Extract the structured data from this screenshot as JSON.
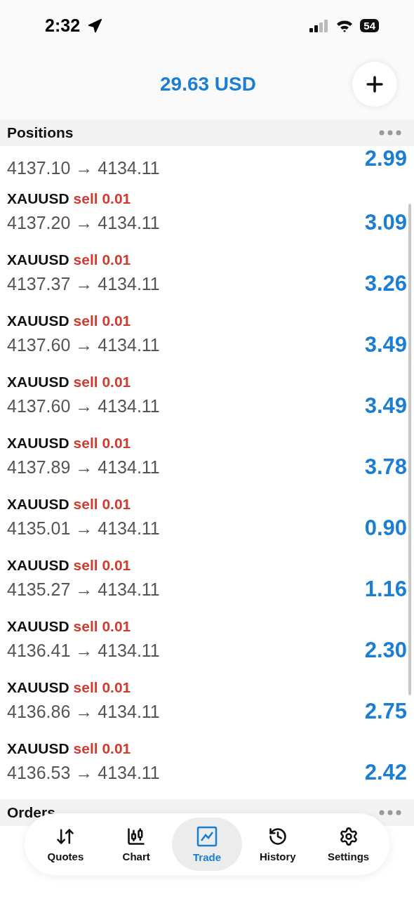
{
  "status_bar": {
    "time": "2:32",
    "battery": "54"
  },
  "account": {
    "balance": "29.63 USD"
  },
  "positions": {
    "title": "Positions",
    "rows": [
      {
        "symbol": "",
        "side": "",
        "prices": "4137.10 → 4134.11",
        "profit": "2.99"
      },
      {
        "symbol": "XAUUSD",
        "side": "sell 0.01",
        "prices": "4137.20 → 4134.11",
        "profit": "3.09"
      },
      {
        "symbol": "XAUUSD",
        "side": "sell 0.01",
        "prices": "4137.37 → 4134.11",
        "profit": "3.26"
      },
      {
        "symbol": "XAUUSD",
        "side": "sell 0.01",
        "prices": "4137.60 → 4134.11",
        "profit": "3.49"
      },
      {
        "symbol": "XAUUSD",
        "side": "sell 0.01",
        "prices": "4137.60 → 4134.11",
        "profit": "3.49"
      },
      {
        "symbol": "XAUUSD",
        "side": "sell 0.01",
        "prices": "4137.89 → 4134.11",
        "profit": "3.78"
      },
      {
        "symbol": "XAUUSD",
        "side": "sell 0.01",
        "prices": "4135.01 → 4134.11",
        "profit": "0.90"
      },
      {
        "symbol": "XAUUSD",
        "side": "sell 0.01",
        "prices": "4135.27 → 4134.11",
        "profit": "1.16"
      },
      {
        "symbol": "XAUUSD",
        "side": "sell 0.01",
        "prices": "4136.41 → 4134.11",
        "profit": "2.30"
      },
      {
        "symbol": "XAUUSD",
        "side": "sell 0.01",
        "prices": "4136.86 → 4134.11",
        "profit": "2.75"
      },
      {
        "symbol": "XAUUSD",
        "side": "sell 0.01",
        "prices": "4136.53 → 4134.11",
        "profit": "2.42"
      }
    ]
  },
  "orders": {
    "title": "Orders"
  },
  "tab_bar": [
    {
      "label": "Quotes",
      "kind": "quotes",
      "selected": false
    },
    {
      "label": "Chart",
      "kind": "chart",
      "selected": false
    },
    {
      "label": "Trade",
      "kind": "trade",
      "selected": true
    },
    {
      "label": "History",
      "kind": "history",
      "selected": false
    },
    {
      "label": "Settings",
      "kind": "settings",
      "selected": false
    }
  ]
}
